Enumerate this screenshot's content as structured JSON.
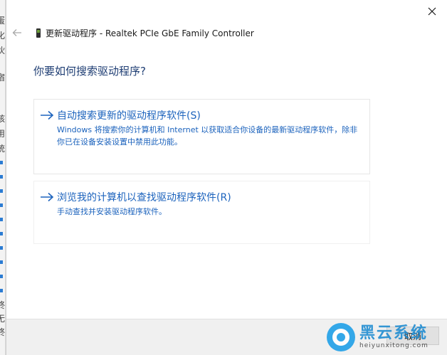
{
  "window": {
    "title": "更新驱动程序 - Realtek PCIe GbE Family Controller"
  },
  "background_window": {
    "chars": [
      "蛋",
      "化",
      "伙",
      "宿",
      "核",
      "用",
      "统",
      "",
      "",
      "",
      "",
      "",
      "",
      "",
      "",
      "",
      "终",
      "无",
      "终"
    ]
  },
  "prompt": {
    "question": "你要如何搜索驱动程序?"
  },
  "options": [
    {
      "title": "自动搜索更新的驱动程序软件(S)",
      "description": "Windows 将搜索你的计算机和 Internet 以获取适合你设备的最新驱动程序软件，除非你已在设备安装设置中禁用此功能。"
    },
    {
      "title": "浏览我的计算机以查找驱动程序软件(R)",
      "description": "手动查找并安装驱动程序软件。"
    }
  ],
  "footer": {
    "cancel_label": "取消"
  },
  "watermark": {
    "name": "黑云系统",
    "url": "heiyunxitong.com"
  },
  "colors": {
    "accent": "#1c63bd",
    "question": "#1e3d73",
    "footer_bg": "#f0f0f0"
  },
  "icons": {
    "close": "close-icon",
    "back": "back-arrow-icon",
    "device": "network-adapter-icon",
    "option_arrow": "right-arrow-icon"
  }
}
